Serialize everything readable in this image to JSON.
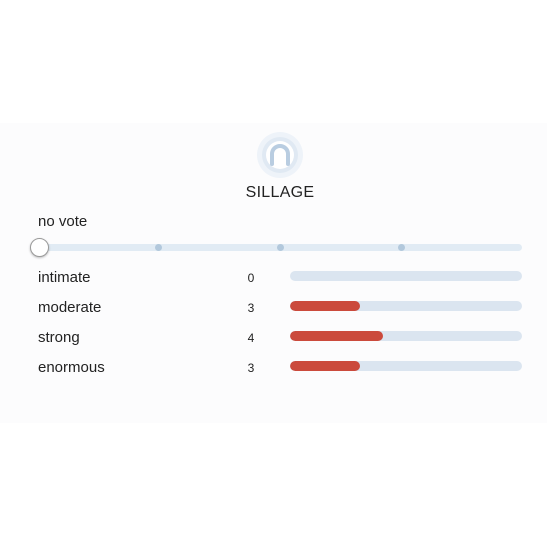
{
  "section": {
    "title": "SILLAGE",
    "icon": "sillage-icon"
  },
  "vote": {
    "status": "no vote",
    "slider_level": 0,
    "slider_steps": 5
  },
  "colors": {
    "fill": "#cb4a3c",
    "track": "#dbe5f0",
    "slider_track": "#e1ebf4",
    "slider_dot": "#b2c8dc",
    "icon": "#b9cde1"
  },
  "rows": [
    {
      "label": "intimate",
      "count": "0",
      "fraction": 0.0
    },
    {
      "label": "moderate",
      "count": "3",
      "fraction": 0.3
    },
    {
      "label": "strong",
      "count": "4",
      "fraction": 0.4
    },
    {
      "label": "enormous",
      "count": "3",
      "fraction": 0.3
    }
  ]
}
